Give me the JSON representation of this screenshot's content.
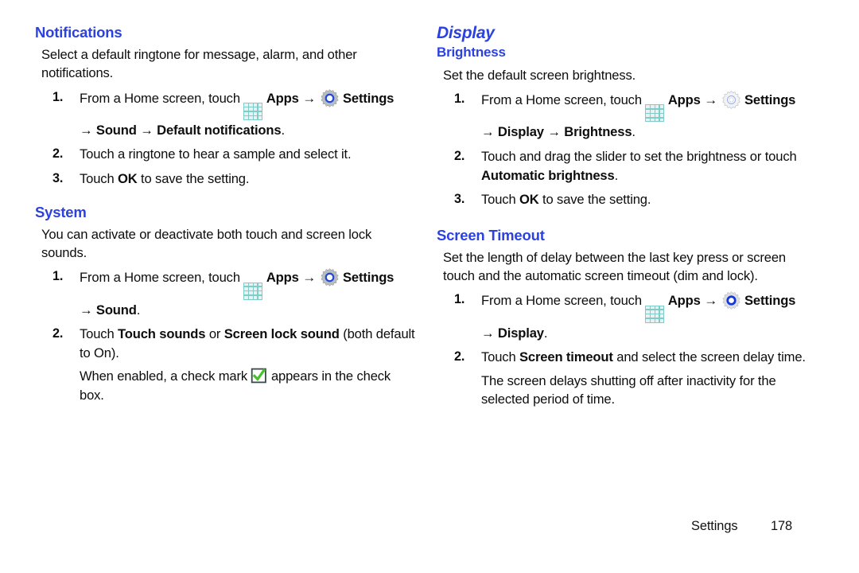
{
  "document": {
    "type": "user-manual-page",
    "colors": {
      "heading_blue": "#2b41e0",
      "body_text": "#0d0d0d",
      "apps_icon_teal": "#7ecdc8",
      "gear_blue": "#1f49d6",
      "check_green": "#46c22a"
    }
  },
  "left_column": {
    "notifications": {
      "heading": "Notifications",
      "intro": "Select a default ringtone for message, alarm, and other notifications.",
      "steps": [
        {
          "num": "1.",
          "lead": "From a Home screen, touch",
          "apps_label": "Apps",
          "arrow": "→",
          "settings_label": "Settings",
          "path_line": "→ Sound → Default notifications",
          "path_tail": "."
        },
        {
          "num": "2.",
          "text": "Touch a ringtone to hear a sample and select it."
        },
        {
          "num": "3.",
          "pre": "Touch ",
          "bold": "OK",
          "post": " to save the setting."
        }
      ]
    },
    "system": {
      "heading": "System",
      "intro": "You can activate or deactivate both touch and screen lock sounds.",
      "steps": [
        {
          "num": "1.",
          "lead": "From a Home screen, touch",
          "apps_label": "Apps",
          "arrow": "→",
          "settings_label": "Settings",
          "path_line": "→ Sound",
          "path_tail": "."
        },
        {
          "num": "2.",
          "pre": "Touch ",
          "bold1": "Touch sounds",
          "mid": " or ",
          "bold2": "Screen lock sound",
          "post": " (both default to On).",
          "note_pre": "When enabled, a check mark ",
          "note_post": " appears in the check box."
        }
      ]
    }
  },
  "right_column": {
    "display": {
      "heading": "Display"
    },
    "brightness": {
      "heading": "Brightness",
      "intro": "Set the default screen brightness.",
      "steps": [
        {
          "num": "1.",
          "lead": "From a Home screen, touch",
          "apps_label": "Apps",
          "arrow": "→",
          "settings_label": "Settings",
          "path_line": "→ Display → Brightness",
          "path_tail": "."
        },
        {
          "num": "2.",
          "pre": "Touch and drag the slider to set the brightness or touch ",
          "bold": "Automatic brightness",
          "post": "."
        },
        {
          "num": "3.",
          "pre": "Touch ",
          "bold": "OK",
          "post": " to save the setting."
        }
      ]
    },
    "screen_timeout": {
      "heading": "Screen Timeout",
      "intro": "Set the length of delay between the last key press or screen touch and the automatic screen timeout (dim and lock).",
      "steps": [
        {
          "num": "1.",
          "lead": "From a Home screen, touch",
          "apps_label": "Apps",
          "arrow": "→",
          "settings_label": "Settings",
          "path_line": "→ Display",
          "path_tail": "."
        },
        {
          "num": "2.",
          "pre": "Touch ",
          "bold": "Screen timeout",
          "post": " and select the screen delay time.",
          "note": "The screen delays shutting off after inactivity for the selected period of time."
        }
      ]
    }
  },
  "footer": {
    "label": "Settings",
    "page_number": "178"
  }
}
